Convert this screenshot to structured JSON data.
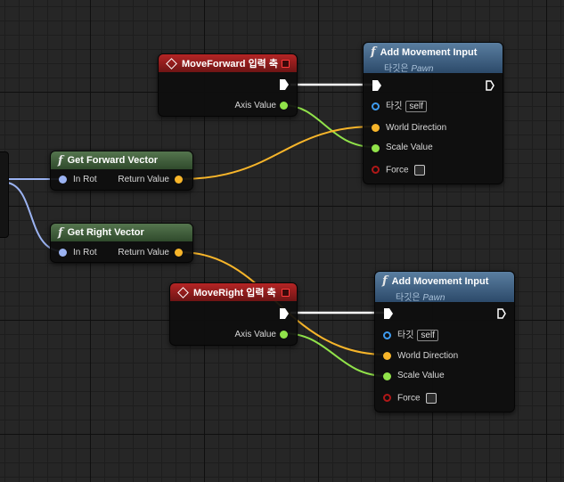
{
  "colors": {
    "exec": "#ffffff",
    "vector": "#f7b52a",
    "float": "#91e34a",
    "rotator": "#9bb3f2",
    "object": "#3e9bf0",
    "bool": "#b01818",
    "event_header": "#b52525",
    "pure_header": "#55754e",
    "function_header": "#5a7ea0"
  },
  "nodes": {
    "move_forward_event": {
      "icon": "diamond-icon",
      "title": "MoveForward 입력 축",
      "axis_value": "Axis Value"
    },
    "add_movement_input_1": {
      "icon": "function-icon",
      "title": "Add Movement Input",
      "target_label": "타깃은",
      "target_class": "Pawn",
      "pin_target": "타깃",
      "target_default": "self",
      "pin_world_direction": "World Direction",
      "pin_scale_value": "Scale Value",
      "pin_force": "Force"
    },
    "get_forward_vector": {
      "icon": "function-icon",
      "title": "Get Forward Vector",
      "pin_in": "In Rot",
      "pin_out": "Return Value"
    },
    "get_right_vector": {
      "icon": "function-icon",
      "title": "Get Right Vector",
      "pin_in": "In Rot",
      "pin_out": "Return Value"
    },
    "move_right_event": {
      "icon": "diamond-icon",
      "title": "MoveRight 입력 축",
      "axis_value": "Axis Value"
    },
    "add_movement_input_2": {
      "icon": "function-icon",
      "title": "Add Movement Input",
      "target_label": "타깃은",
      "target_class": "Pawn",
      "pin_target": "타깃",
      "target_default": "self",
      "pin_world_direction": "World Direction",
      "pin_scale_value": "Scale Value",
      "pin_force": "Force"
    }
  }
}
